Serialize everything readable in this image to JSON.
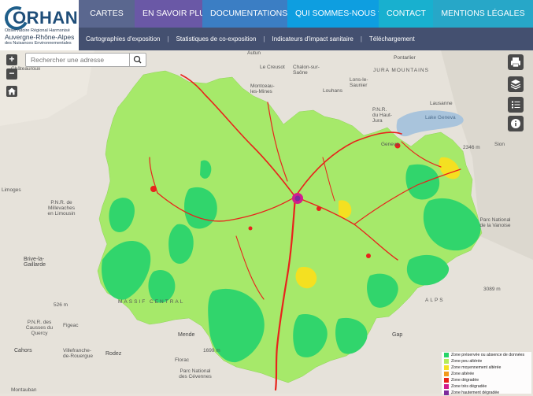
{
  "logo": {
    "title": "ORHANE",
    "line1": "Observatoire Régional Harmonisé",
    "line2": "Auvergne-Rhône-Alpes",
    "line3": "des Nuisances Environnementales"
  },
  "nav": {
    "items": [
      {
        "label": "CARTES",
        "color": "#5a678f"
      },
      {
        "label": "EN SAVOIR PLUS",
        "color": "#6a58a6"
      },
      {
        "label": "DOCUMENTATIONS",
        "color": "#3b7ec4"
      },
      {
        "label": "QUI SOMMES-NOUS ?",
        "color": "#0e9ee0"
      },
      {
        "label": "CONTACT",
        "color": "#18b0cf"
      },
      {
        "label": "MENTIONS LÉGALES",
        "color": "#27a7c8"
      }
    ]
  },
  "subnav": {
    "items": [
      "Cartographies d'exposition",
      "Statistiques de co-exposition",
      "Indicateurs d'impact sanitaire",
      "Téléchargement"
    ]
  },
  "search": {
    "placeholder": "Rechercher une adresse"
  },
  "controls": {
    "zoom_in": "+",
    "zoom_out": "−"
  },
  "places": {
    "autun": "Autun",
    "le_creusot": "Le Creusot",
    "chalon": "Chalon-sur-Saône",
    "pontarlier": "Pontarlier",
    "jura_mountains": "JURA MOUNTAINS",
    "lons": "Lons-le-Saunier",
    "montceau": "Montceau-les-Mines",
    "louhans": "Louhans",
    "chateauroux": "Châteauroux",
    "pnr_haut_jura": "P.N.R. du Haut-Jura",
    "lausanne": "Lausanne",
    "lac_geneve": "Lake Geneva",
    "geneva": "Geneva",
    "limoges": "Limoges",
    "pnr_millevaches": "P.N.R. de Millevaches en Limousin",
    "brive": "Brive-la-Gaillarde",
    "massif": "MASSIF CENTRAL",
    "pnr_quercy": "P.N.R. des Causses du Quercy",
    "figeac": "Figeac",
    "cahors": "Cahors",
    "villefranche": "Villefranche-de-Rouergue",
    "rodez": "Rodez",
    "mende": "Mende",
    "florac": "Florac",
    "pnr_cevennes": "Parc National des Cévennes",
    "montauban": "Montauban",
    "gap": "Gap",
    "sion": "Sion",
    "parc_vanoise": "Parc National de la Vanoise",
    "alps": "ALPS",
    "elev_526": "526 m",
    "elev_2346": "2346 m",
    "elev_3089": "3089 m",
    "elev_1699": "1699 m"
  },
  "legend": {
    "items": [
      {
        "label": "Zone préservée ou absence de données",
        "color": "#28d468"
      },
      {
        "label": "Zone peu altérée",
        "color": "#b4ec5a"
      },
      {
        "label": "Zone moyennement altérée",
        "color": "#f4e021"
      },
      {
        "label": "Zone altérée",
        "color": "#f29a1d"
      },
      {
        "label": "Zone dégradée",
        "color": "#e8231c"
      },
      {
        "label": "Zone très dégradée",
        "color": "#d21d8e"
      },
      {
        "label": "Zone hautement dégradée",
        "color": "#7d2a9d"
      }
    ]
  }
}
